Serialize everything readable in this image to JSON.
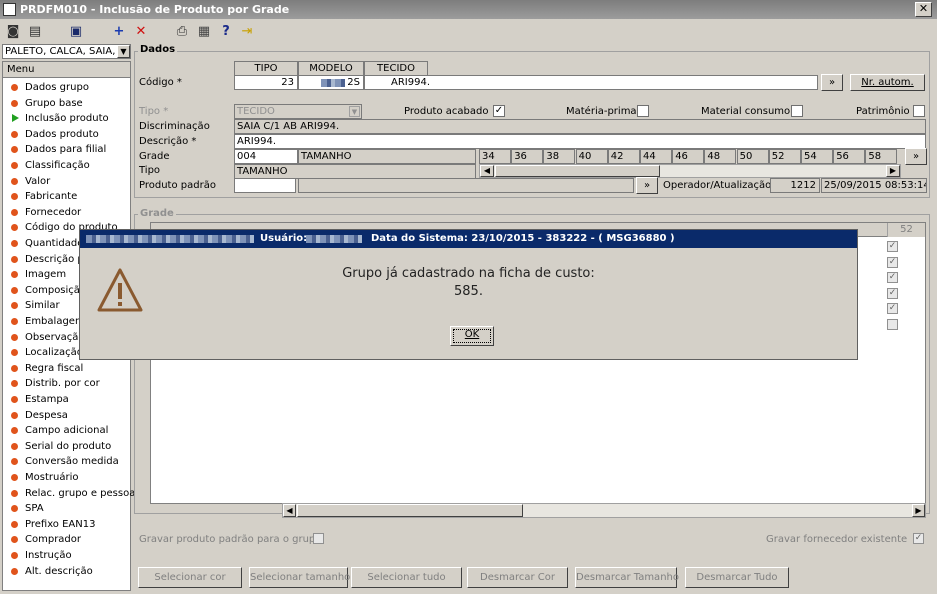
{
  "window": {
    "title": "PRDFM010 - Inclusão de Produto por Grade"
  },
  "toolbar": {
    "icons": [
      "nav-first-icon",
      "nav-list-icon",
      "save-icon",
      "add-icon",
      "delete-icon",
      "print-icon",
      "calculator-icon",
      "help-icon",
      "exit-icon"
    ]
  },
  "combo": {
    "value": "PALETO, CALCA, SAIA,"
  },
  "menu": {
    "header": "Menu",
    "items": [
      "Dados grupo",
      "Grupo base",
      "Inclusão produto",
      "Dados produto",
      "Dados para filial",
      "Classificação",
      "Valor",
      "Fabricante",
      "Fornecedor",
      "Código do produto",
      "Quantidade",
      "Descrição p",
      "Imagem",
      "Composição",
      "Similar",
      "Embalagem",
      "Observação",
      "Localização",
      "Regra fiscal",
      "Distrib. por cor",
      "Estampa",
      "Despesa",
      "Campo adicional",
      "Serial do produto",
      "Conversão medida",
      "Mostruário",
      "Relac. grupo e pessoa",
      "SPA",
      "Prefixo EAN13",
      "Comprador",
      "Instrução",
      "Alt. descrição"
    ]
  },
  "dados": {
    "title": "Dados",
    "col_tipo": "TIPO",
    "col_modelo": "MODELO",
    "col_tecido": "TECIDO",
    "codigo_label": "Código *",
    "tipo_val": "23",
    "modelo_val": "2S",
    "tecido_val": "ARI994.",
    "more_btn": "»",
    "nr_autom": "Nr. autom.",
    "tipo_label": "Tipo *",
    "tipo_combo": "TECIDO",
    "produto_acabado": "Produto acabado",
    "produto_acabado_check": "✓",
    "materia_prima": "Matéria-prima",
    "material_consumo": "Material consumo",
    "patrimonio": "Patrimônio",
    "discriminacao_label": "Discriminação",
    "discriminacao_val": "SAIA C/1 AB ARI994.",
    "descricao_label": "Descrição *",
    "descricao_val": "ARI994.",
    "grade_label": "Grade",
    "grade_code": "004",
    "grade_name": "TAMANHO",
    "sizes": [
      "34",
      "36",
      "38",
      "40",
      "42",
      "44",
      "46",
      "48",
      "50",
      "52",
      "54",
      "56",
      "58"
    ],
    "tipo2_label": "Tipo",
    "tipo2_val": "TAMANHO",
    "produto_padrao_label": "Produto padrão",
    "operador_label": "Operador/Atualização",
    "operador_val": "1212",
    "data_val": "25/09/2015 08:53:14"
  },
  "grade": {
    "title": "Grade",
    "col52": "52",
    "checks": [
      "✓",
      "✓",
      "✓",
      "✓",
      "✓",
      ""
    ],
    "gravar_padrao": "Gravar produto padrão para o grupo",
    "gravar_fornecedor": "Gravar fornecedor existente",
    "gravar_fornecedor_check": "✓"
  },
  "buttons": [
    "Selecionar cor",
    "Selecionar tamanho",
    "Selecionar tudo",
    "Desmarcar Cor",
    "Desmarcar Tamanho",
    "Desmarcar Tudo"
  ],
  "dialog": {
    "usuario": "Usuário:",
    "data_sistema": "Data do Sistema: 23/10/2015 - 383222 - ( MSG36880 )",
    "message": "Grupo já cadastrado na ficha de custo:",
    "value": "585.",
    "ok": "OK"
  }
}
